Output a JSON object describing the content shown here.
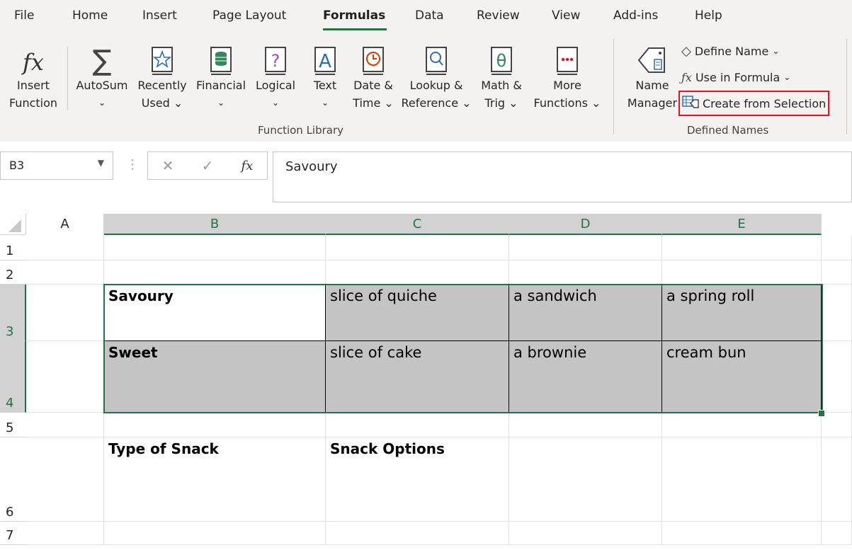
{
  "tabs": [
    "File",
    "Home",
    "Insert",
    "Page Layout",
    "Formulas",
    "Data",
    "Review",
    "View",
    "Add-ins",
    "Help"
  ],
  "active_tab": "Formulas",
  "function_library": {
    "insert_function": [
      "Insert",
      "Function"
    ],
    "autosum": [
      "AutoSum",
      "⌄"
    ],
    "recently_used": [
      "Recently",
      "Used ⌄"
    ],
    "financial": [
      "Financial",
      "⌄"
    ],
    "logical": [
      "Logical",
      "⌄"
    ],
    "text": [
      "Text",
      "⌄"
    ],
    "date_time": [
      "Date &",
      "Time ⌄"
    ],
    "lookup_reference": [
      "Lookup &",
      "Reference ⌄"
    ],
    "math_trig": [
      "Math &",
      "Trig ⌄"
    ],
    "more_functions": [
      "More",
      "Functions ⌄"
    ],
    "group_label": "Function Library"
  },
  "defined_names": {
    "name_manager": [
      "Name",
      "Manager"
    ],
    "define_name": "Define Name",
    "use_in_formula": "Use in Formula",
    "create_from_selection": "Create from Selection",
    "group_label": "Defined Names"
  },
  "formula_bar": {
    "name_box": "B3",
    "fx": "fx",
    "cancel": "✕",
    "enter": "✓",
    "content": "Savoury"
  },
  "columns": [
    "A",
    "B",
    "C",
    "D",
    "E"
  ],
  "rows": [
    "1",
    "2",
    "3",
    "4",
    "5",
    "6",
    "7"
  ],
  "cells": {
    "B3": "Savoury",
    "C3": "slice of quiche",
    "D3": "a sandwich",
    "E3": "a spring roll",
    "B4": "Sweet",
    "C4": "slice of cake",
    "D4": "a brownie",
    "E4": "cream bun",
    "B6": "Type of Snack",
    "C6": "Snack Options"
  },
  "colors": {
    "accent": "#217346",
    "highlight": "#e81123",
    "selection_fill": "#c4c4c4"
  }
}
